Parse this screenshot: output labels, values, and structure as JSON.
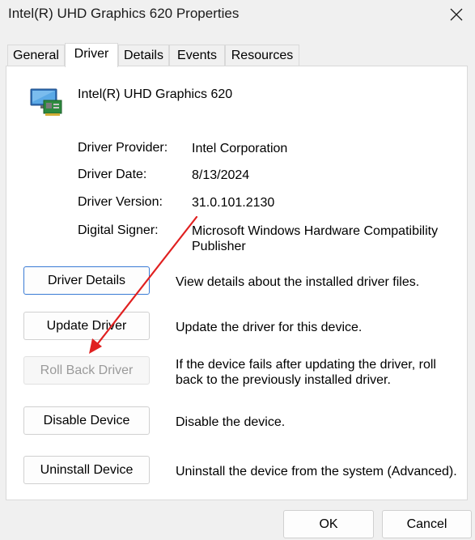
{
  "window": {
    "title": "Intel(R) UHD Graphics 620 Properties"
  },
  "tabs": [
    {
      "label": "General"
    },
    {
      "label": "Driver"
    },
    {
      "label": "Details"
    },
    {
      "label": "Events"
    },
    {
      "label": "Resources"
    }
  ],
  "active_tab": "Driver",
  "device": {
    "name": "Intel(R) UHD Graphics 620",
    "icon": "display-adapter-icon"
  },
  "info": {
    "provider_label": "Driver Provider:",
    "provider_value": "Intel Corporation",
    "date_label": "Driver Date:",
    "date_value": "8/13/2024",
    "version_label": "Driver Version:",
    "version_value": "31.0.101.2130",
    "signer_label": "Digital Signer:",
    "signer_value_line1": "Microsoft Windows Hardware Compatibility",
    "signer_value_line2": "Publisher"
  },
  "actions": {
    "details_label": "Driver Details",
    "details_desc": "View details about the installed driver files.",
    "update_label": "Update Driver",
    "update_desc": "Update the driver for this device.",
    "rollback_label": "Roll Back Driver",
    "rollback_desc_line1": "If the device fails after updating the driver, roll",
    "rollback_desc_line2": "back to the previously installed driver.",
    "disable_label": "Disable Device",
    "disable_desc": "Disable the device.",
    "uninstall_label": "Uninstall Device",
    "uninstall_desc": "Uninstall the device from the system (Advanced)."
  },
  "footer": {
    "ok_label": "OK",
    "cancel_label": "Cancel"
  },
  "colors": {
    "annotation_arrow": "#e02020",
    "focus_border": "#3a7bd5"
  }
}
